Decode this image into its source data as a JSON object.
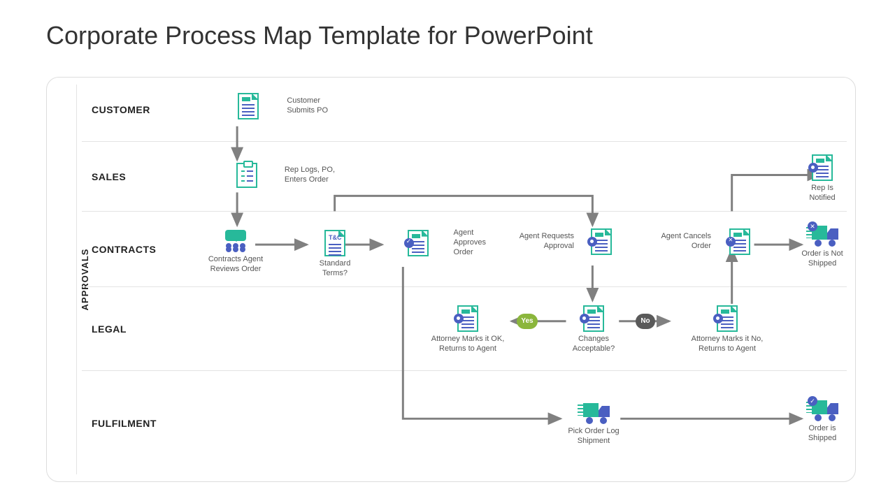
{
  "title": "Corporate Process Map Template for PowerPoint",
  "sidebar_label": "APPROVALS",
  "lanes": {
    "customer": "CUSTOMER",
    "sales": "SALES",
    "contracts": "CONTRACTS",
    "legal": "LEGAL",
    "fulfilment": "FULFILMENT"
  },
  "nodes": {
    "customer_submits": "Customer\nSubmits PO",
    "rep_logs": "Rep Logs, PO,\nEnters Order",
    "contracts_agent": "Contracts Agent\nReviews Order",
    "standard_terms": "Standard\nTerms?",
    "agent_approves": "Agent\nApproves\nOrder",
    "agent_requests": "Agent Requests\nApproval",
    "agent_cancels": "Agent Cancels\nOrder",
    "attorney_ok": "Attorney Marks it OK,\nReturns to Agent",
    "changes_acceptable": "Changes\nAcceptable?",
    "attorney_no": "Attorney Marks it No,\nReturns to Agent",
    "rep_notified": "Rep Is\nNotified",
    "not_shipped": "Order is Not\nShipped",
    "pick_order": "Pick Order Log\nShipment",
    "shipped": "Order is\nShipped",
    "tc_label": "T&C"
  },
  "decisions": {
    "yes": "Yes",
    "no": "No"
  }
}
